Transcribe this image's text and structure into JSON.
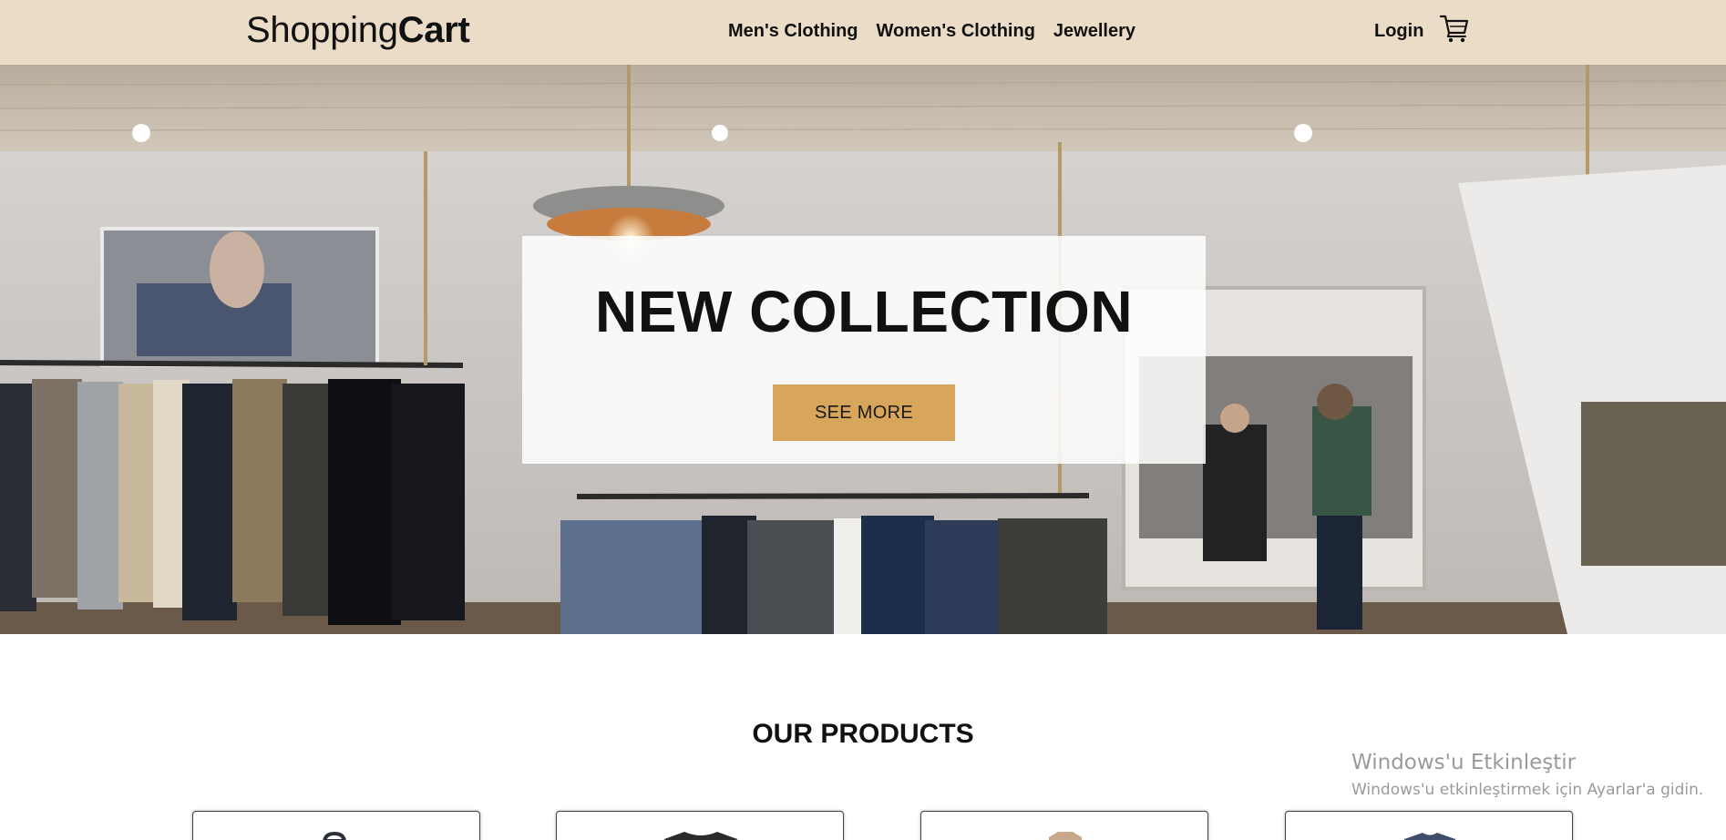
{
  "header": {
    "logo_light": "Shopping",
    "logo_bold": "Cart",
    "nav": [
      {
        "label": "Men's Clothing"
      },
      {
        "label": "Women's Clothing"
      },
      {
        "label": "Jewellery"
      }
    ],
    "login_label": "Login",
    "cart_icon": "shopping-cart-icon"
  },
  "hero": {
    "title": "NEW COLLECTION",
    "button_label": "SEE MORE",
    "background": "clothing-store-interior-photo",
    "button_color": "#d8a65a"
  },
  "products": {
    "title": "OUR PRODUCTS",
    "items": [
      {
        "image": "backpack-image"
      },
      {
        "image": "dark-tshirt-image"
      },
      {
        "image": "jacket-image"
      },
      {
        "image": "blue-tshirt-image"
      }
    ]
  },
  "watermark": {
    "title": "Windows'u Etkinleştir",
    "subtitle": "Windows'u etkinleştirmek için Ayarlar'a gidin."
  },
  "colors": {
    "header_bg": "#ebdcc7",
    "accent": "#d8a65a"
  }
}
